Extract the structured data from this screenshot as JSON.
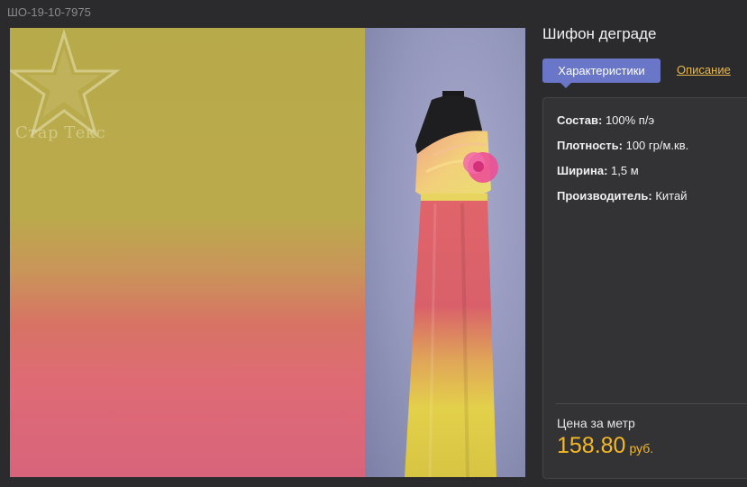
{
  "sku": "ШО-19-10-7975",
  "brand": {
    "logo_text": "STARtex",
    "caption": "Стар Текс"
  },
  "product": {
    "title": "Шифон деграде"
  },
  "tabs": {
    "active_label": "Характеристики",
    "secondary_label": "Описание"
  },
  "specs": [
    {
      "label": "Состав:",
      "value": "100% п/э"
    },
    {
      "label": "Плотность:",
      "value": "100 гр/м.кв."
    },
    {
      "label": "Ширина:",
      "value": "1,5 м"
    },
    {
      "label": "Производитель:",
      "value": "Китай"
    }
  ],
  "price": {
    "label": "Цена за метр",
    "value": "158.80",
    "currency": "руб."
  },
  "colors": {
    "tab_active": "#6a76c8",
    "price": "#f5b928",
    "link": "#e8b84a"
  }
}
